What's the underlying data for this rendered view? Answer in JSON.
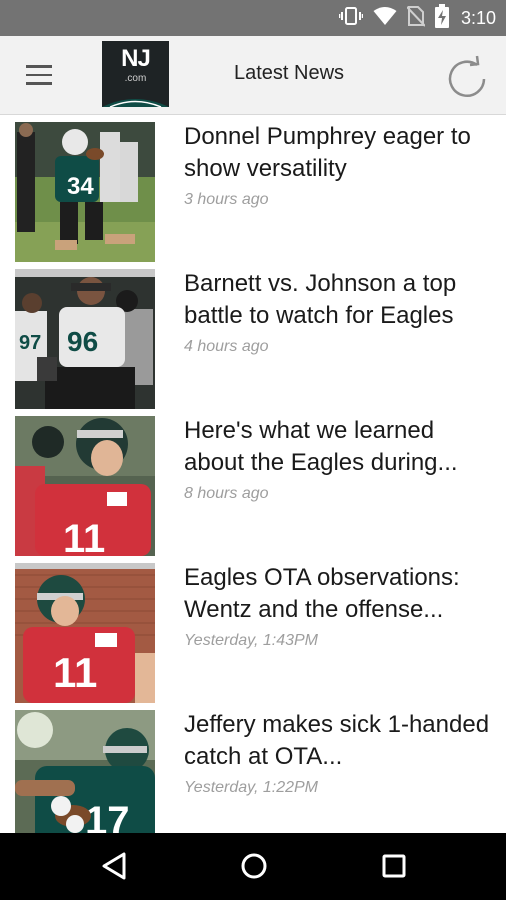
{
  "status_bar": {
    "time": "3:10",
    "icons": [
      "vibrate-icon",
      "wifi-icon",
      "no-sim-icon",
      "battery-charging-icon"
    ]
  },
  "app_bar": {
    "title": "Latest News",
    "logo_text": "NJ",
    "logo_subtext": ".com",
    "menu_icon": "hamburger-menu-icon",
    "refresh_icon": "refresh-icon"
  },
  "articles": [
    {
      "headline": "Donnel Pumphrey eager to show versatility",
      "time": "3 hours ago",
      "jersey": "34"
    },
    {
      "headline": "Barnett vs. Johnson a top battle to watch for Eagles",
      "time": "4 hours ago",
      "jersey": "96"
    },
    {
      "headline": "Here's what we learned about the Eagles during...",
      "time": "8 hours ago",
      "jersey": "11"
    },
    {
      "headline": "Eagles OTA observations: Wentz and the offense...",
      "time": "Yesterday, 1:43PM",
      "jersey": "11"
    },
    {
      "headline": "Jeffery makes sick 1-handed catch at OTA...",
      "time": "Yesterday, 1:22PM",
      "jersey": "17"
    }
  ],
  "nav_bar": {
    "back_icon": "back-triangle-icon",
    "home_icon": "home-circle-icon",
    "recents_icon": "recents-square-icon"
  },
  "colors": {
    "status_bar": "#737373",
    "app_bar": "#f2f2f2",
    "eagles_green": "#0f4c46",
    "red_jersey": "#d1313c",
    "timestamp": "#9e9e9e"
  }
}
